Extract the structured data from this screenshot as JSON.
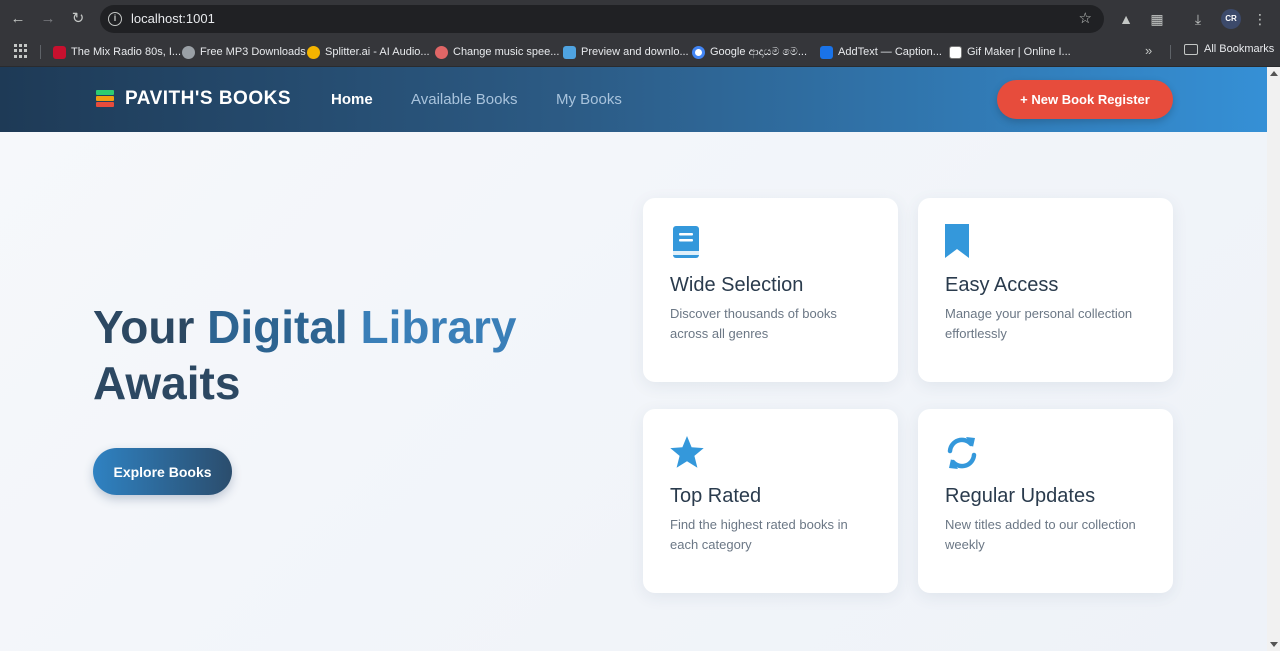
{
  "browser": {
    "url": "localhost:1001",
    "bookmarks": [
      {
        "label": "The Mix Radio 80s, I...",
        "color": "#c8102e"
      },
      {
        "label": "Free MP3 Downloads",
        "color": "#9aa0a6"
      },
      {
        "label": "Splitter.ai - AI Audio...",
        "color": "#f4b400"
      },
      {
        "label": "Change music spee...",
        "color": "#e06666"
      },
      {
        "label": "Preview and downlo...",
        "color": "#4fa3e0"
      },
      {
        "label": "Google ආදායම මෙ...",
        "color": "#4285f4"
      },
      {
        "label": "AddText — Caption...",
        "color": "#1a73e8"
      },
      {
        "label": "Gif Maker | Online I...",
        "color": "#ffffff"
      }
    ],
    "all_bookmarks_label": "All Bookmarks"
  },
  "navbar": {
    "brand": "PAVITH'S BOOKS",
    "links": [
      {
        "label": "Home",
        "active": true
      },
      {
        "label": "Available Books",
        "active": false
      },
      {
        "label": "My Books",
        "active": false
      }
    ],
    "register_button": "+ New Book Register"
  },
  "hero": {
    "title_part1": "Your ",
    "title_part2": "Digital",
    "title_part3": " ",
    "title_part4": "Library",
    "title_part5": "Awaits",
    "cta": "Explore Books"
  },
  "features": [
    {
      "icon": "book-icon",
      "title": "Wide Selection",
      "description": "Discover thousands of books across all genres"
    },
    {
      "icon": "bookmark-icon",
      "title": "Easy Access",
      "description": "Manage your personal collection effortlessly"
    },
    {
      "icon": "star-icon",
      "title": "Top Rated",
      "description": "Find the highest rated books in each category"
    },
    {
      "icon": "sync-icon",
      "title": "Regular Updates",
      "description": "New titles added to our collection weekly"
    }
  ],
  "colors": {
    "accent": "#3498db",
    "register": "#e74c3c",
    "navbar_dark": "#1e3a56"
  }
}
